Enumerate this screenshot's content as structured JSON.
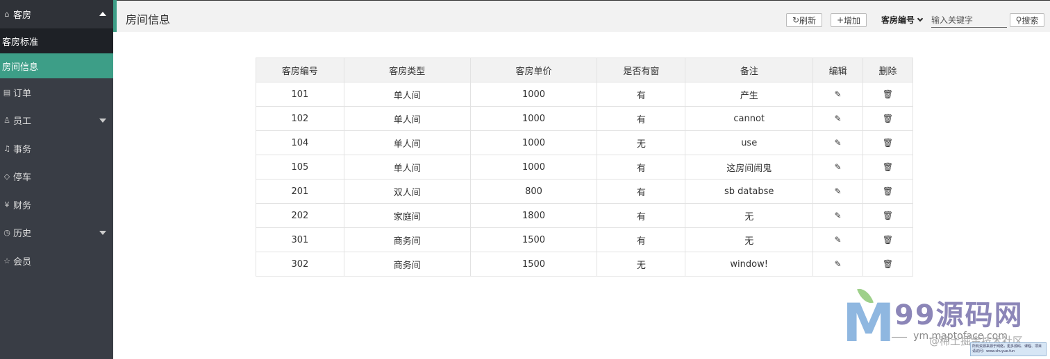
{
  "sidebar": {
    "header": {
      "icon": "home-icon",
      "label": "客房"
    },
    "sub_items": [
      {
        "label": "客房标准"
      },
      {
        "label": "房间信息"
      }
    ],
    "items": [
      {
        "icon": "clipboard-icon",
        "label": "订单"
      },
      {
        "icon": "user-icon",
        "label": "员工"
      },
      {
        "icon": "bell-icon",
        "label": "事务"
      },
      {
        "icon": "tag-icon",
        "label": "停车"
      },
      {
        "icon": "yen-icon",
        "label": "财务"
      },
      {
        "icon": "clock-icon",
        "label": "历史"
      },
      {
        "icon": "star-icon",
        "label": "会员"
      }
    ]
  },
  "header": {
    "title": "房间信息",
    "refresh_label": "刷新",
    "add_label": "增加",
    "search_field": "客房编号",
    "search_placeholder": "输入关键字",
    "search_label": "搜索"
  },
  "table": {
    "columns": [
      "客房编号",
      "客房类型",
      "客房单价",
      "是否有窗",
      "备注",
      "编辑",
      "删除"
    ],
    "rows": [
      [
        "101",
        "单人间",
        "1000",
        "有",
        "产生"
      ],
      [
        "102",
        "单人间",
        "1000",
        "有",
        "cannot"
      ],
      [
        "104",
        "单人间",
        "1000",
        "无",
        "use"
      ],
      [
        "105",
        "单人间",
        "1000",
        "有",
        "这房间闹鬼"
      ],
      [
        "201",
        "双人间",
        "800",
        "有",
        "sb databse"
      ],
      [
        "202",
        "家庭间",
        "1800",
        "有",
        "无"
      ],
      [
        "301",
        "商务间",
        "1500",
        "有",
        "无"
      ],
      [
        "302",
        "商务间",
        "1500",
        "无",
        "window!"
      ]
    ]
  },
  "watermark": {
    "title": "99源码网",
    "url": "ym.maptoface.com",
    "by": "@稀土掘金技术社区",
    "box_text": "所有资源来源于网络，更多源码、课程、项目请访问：www.shuyue.fun"
  },
  "colors": {
    "sidebar_bg": "#393d45",
    "sidebar_header_bg": "#2f3238",
    "active": "#3d9e87",
    "topbar_bg": "#f2f2f2"
  }
}
